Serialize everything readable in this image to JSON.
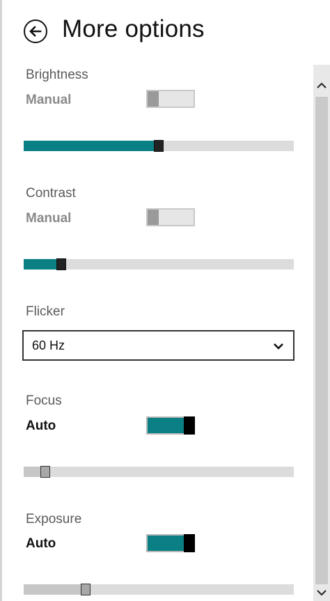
{
  "header": {
    "title": "More options",
    "back_icon": "back-arrow-circle-icon"
  },
  "brightness": {
    "label": "Brightness",
    "mode": "Manual",
    "auto": false,
    "level": 0.5
  },
  "contrast": {
    "label": "Contrast",
    "mode": "Manual",
    "auto": false,
    "level": 0.14
  },
  "flicker": {
    "label": "Flicker",
    "value": "60 Hz"
  },
  "focus": {
    "label": "Focus",
    "mode": "Auto",
    "auto": true,
    "level": 0.08
  },
  "exposure": {
    "label": "Exposure",
    "mode": "Auto",
    "auto": true,
    "level": 0.23
  },
  "colors": {
    "accent": "#0a7f84",
    "track": "#dcdcdc"
  }
}
